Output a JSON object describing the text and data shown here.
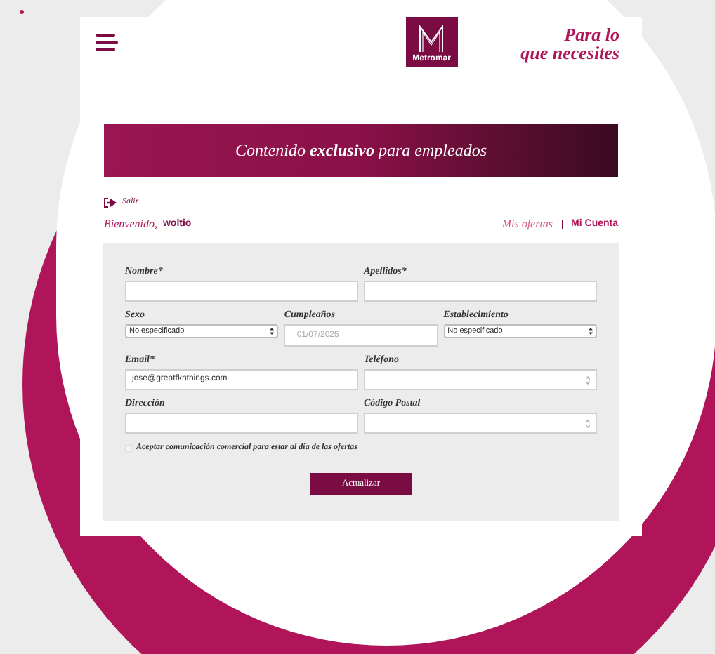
{
  "header": {
    "logo_text": "Metromar",
    "slogan": [
      "Para lo",
      "que necesites"
    ]
  },
  "banner": {
    "text": "Contenido **exclusivo** para empleados"
  },
  "logout": {
    "label": "Salir"
  },
  "welcome": {
    "label": "Bienvenido,",
    "user": "woltio"
  },
  "nav": [
    {
      "label": "Mis ofertas",
      "selected": false
    },
    {
      "label": "Mi Cuenta",
      "selected": true
    }
  ],
  "form": {
    "rows": [
      [
        {
          "label": "Nombre*",
          "kind": "text"
        },
        {
          "label": "Apellidos*",
          "kind": "text"
        }
      ],
      [
        {
          "label": "Sexo",
          "kind": "select",
          "value": "No especificado"
        },
        {
          "label": "Cumpleaños",
          "kind": "date",
          "value": "01/07/2025"
        },
        {
          "label": "Establecimiento",
          "kind": "select",
          "value": "No especificado"
        }
      ],
      [
        {
          "label": "Email*",
          "kind": "text",
          "value": "jose@greatfknthings.com"
        },
        {
          "label": "Teléfono",
          "kind": "number"
        }
      ],
      [
        {
          "label": "Dirección",
          "kind": "text"
        },
        {
          "label": "Código Postal",
          "kind": "number"
        }
      ]
    ],
    "consent": {
      "label": "Aceptar comunicación comercial para estar al día de las ofertas",
      "checked": false
    },
    "submit": "Actualizar"
  }
}
